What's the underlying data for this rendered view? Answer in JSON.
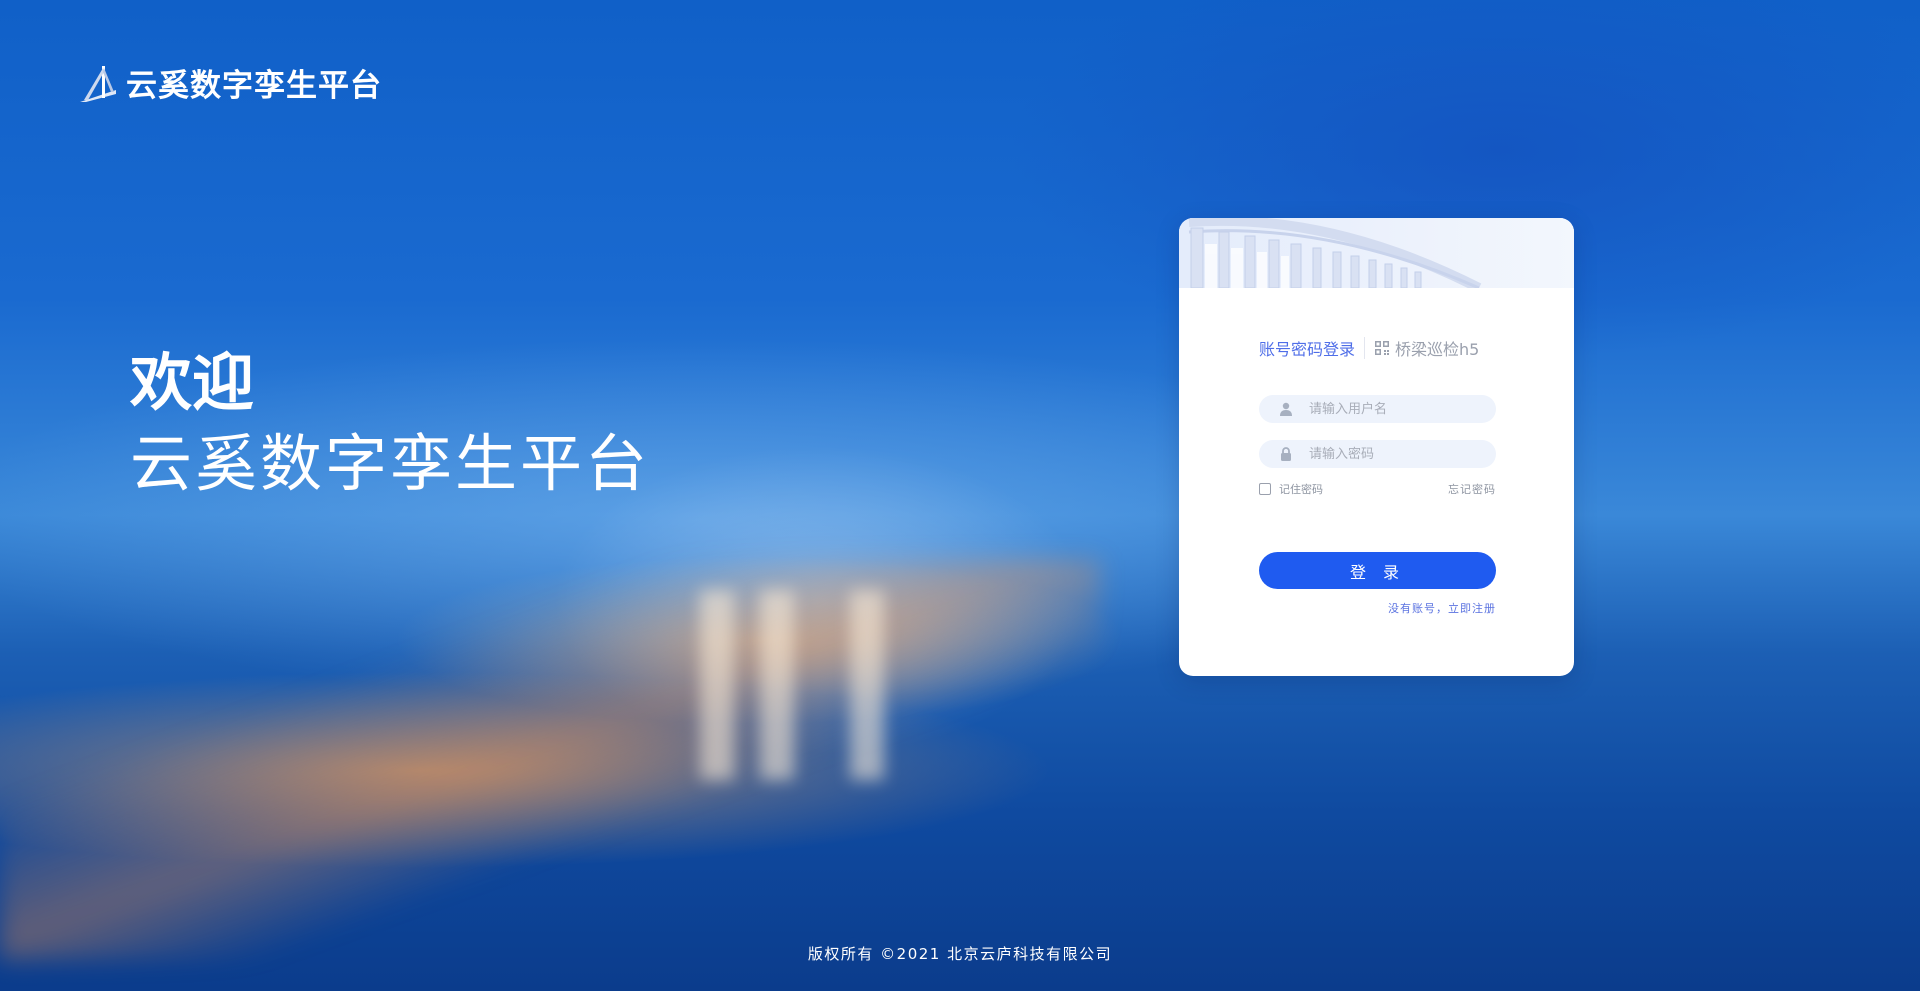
{
  "brand": {
    "name": "云奚数字孪生平台"
  },
  "welcome": {
    "title": "欢迎",
    "subtitle": "云奚数字孪生平台"
  },
  "login_card": {
    "tabs": {
      "active_label": "账号密码登录",
      "inactive_label": "桥梁巡检h5"
    },
    "username": {
      "value": "",
      "placeholder": "请输入用户名"
    },
    "password": {
      "value": "",
      "placeholder": "请输入密码"
    },
    "remember_label": "记住密码",
    "remember_checked": false,
    "forgot_label": "忘记密码",
    "login_label": "登 录",
    "register_label": "没有账号，立即注册"
  },
  "footer": {
    "copyright": "版权所有 ©2021 北京云庐科技有限公司"
  },
  "colors": {
    "accent": "#1f5bf0",
    "tab_active": "#4f6ee8",
    "link": "#5b73e0",
    "field_bg": "#eef3fc"
  },
  "icons": {
    "brand": "bridge-logo-icon",
    "qr": "qr-code-icon",
    "user": "user-icon",
    "lock": "lock-icon"
  }
}
